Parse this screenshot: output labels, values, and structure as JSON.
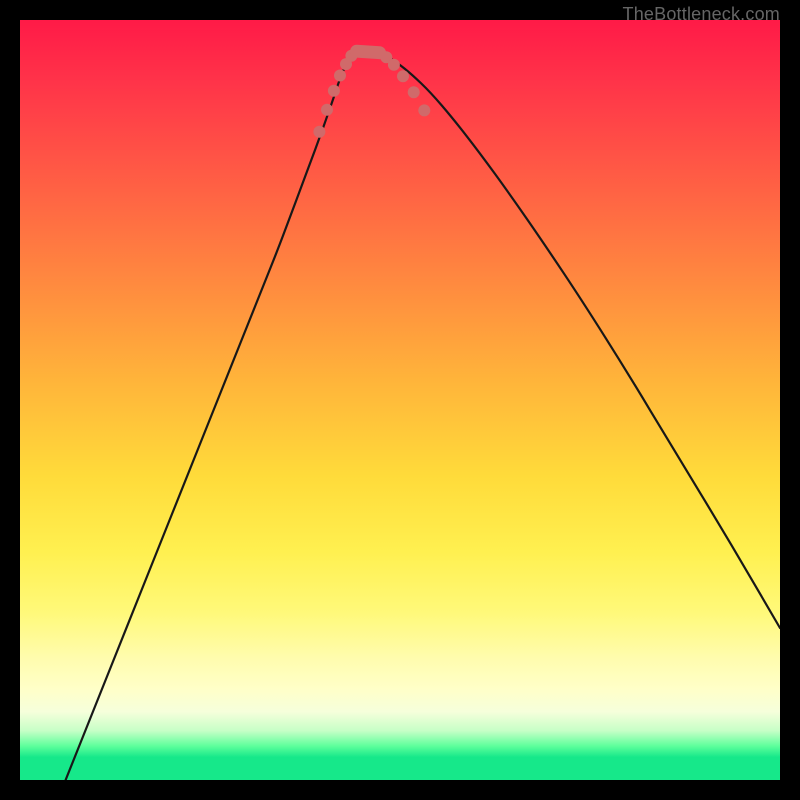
{
  "watermark": "TheBottleneck.com",
  "chart_data": {
    "type": "line",
    "title": "",
    "xlabel": "",
    "ylabel": "",
    "xlim": [
      0,
      100
    ],
    "ylim": [
      0,
      100
    ],
    "curve_x": [
      6,
      10,
      14,
      18,
      22,
      25,
      28,
      30,
      32,
      34,
      35.5,
      37,
      38.3,
      39.4,
      40.3,
      41,
      41.6,
      42.1,
      42.6,
      43,
      43.4,
      43.8,
      44.3,
      44.8,
      45.4,
      46,
      46.8,
      48,
      49.6,
      51.6,
      54,
      57,
      60.5,
      64.5,
      69,
      74,
      80,
      86,
      93,
      100
    ],
    "curve_y": [
      0,
      10,
      20,
      30,
      40,
      47.5,
      55,
      60,
      65,
      70,
      74,
      78,
      81.5,
      84.5,
      87,
      89,
      90.8,
      92.3,
      93.5,
      94.4,
      95.1,
      95.6,
      95.9,
      96,
      96,
      96,
      95.8,
      95.4,
      94.4,
      92.8,
      90.5,
      87,
      82.5,
      77,
      70.5,
      63,
      53.5,
      43.5,
      32,
      20
    ],
    "markers": [
      {
        "x": 39.4,
        "y": 85.3,
        "kind": "dot"
      },
      {
        "x": 40.4,
        "y": 88.2,
        "kind": "dot"
      },
      {
        "x": 41.3,
        "y": 90.7,
        "kind": "dot"
      },
      {
        "x": 42.1,
        "y": 92.7,
        "kind": "dot"
      },
      {
        "x": 42.9,
        "y": 94.2,
        "kind": "dot"
      },
      {
        "x": 43.6,
        "y": 95.3,
        "kind": "dot"
      },
      {
        "x": 44.3,
        "y": 95.9,
        "kind": "pill_start"
      },
      {
        "x": 47.3,
        "y": 95.7,
        "kind": "pill_end"
      },
      {
        "x": 48.2,
        "y": 95.1,
        "kind": "dot"
      },
      {
        "x": 49.2,
        "y": 94.1,
        "kind": "dot"
      },
      {
        "x": 50.4,
        "y": 92.6,
        "kind": "dot"
      },
      {
        "x": 51.8,
        "y": 90.5,
        "kind": "dot"
      },
      {
        "x": 53.2,
        "y": 88.1,
        "kind": "dot"
      }
    ],
    "colors": {
      "gradient_top": "#ff1a47",
      "gradient_mid": "#ffdb3a",
      "gradient_bottom": "#16e88a",
      "curve": "#181818",
      "markers": "#d06a6a"
    }
  }
}
